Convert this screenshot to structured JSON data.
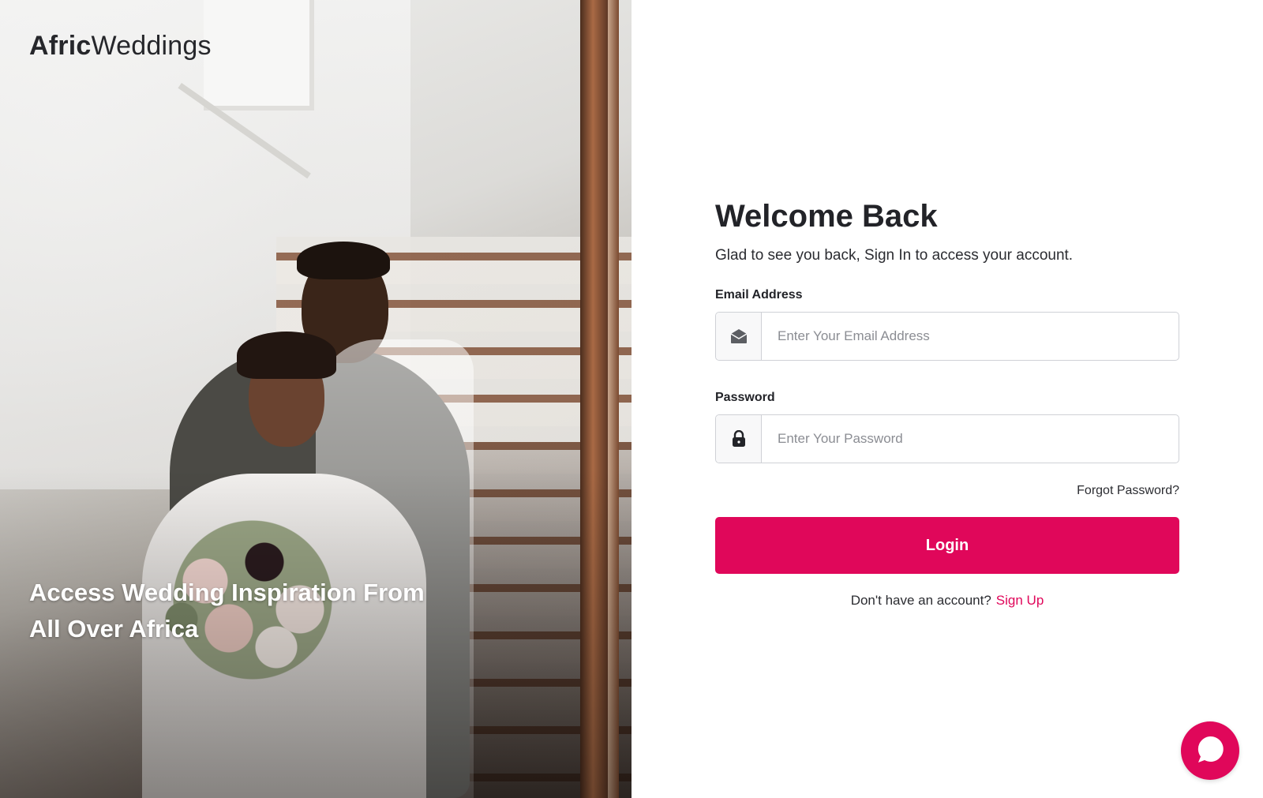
{
  "brand": {
    "name_bold": "Afric",
    "name_light": "Weddings"
  },
  "hero": {
    "tagline_line1": "Access Wedding Inspiration From",
    "tagline_line2": "All Over Africa",
    "image_alt": "Bride and groom seated on a staircase"
  },
  "login": {
    "title": "Welcome Back",
    "subtitle": "Glad to see you back, Sign In to access your account.",
    "email": {
      "label": "Email Address",
      "placeholder": "Enter Your Email Address",
      "value": "",
      "icon": "envelope-icon"
    },
    "password": {
      "label": "Password",
      "placeholder": "Enter Your Password",
      "value": "",
      "icon": "lock-icon"
    },
    "forgot_label": "Forgot Password?",
    "submit_label": "Login",
    "signup_prompt": "Don't have an account?",
    "signup_label": "Sign Up"
  },
  "chat": {
    "icon": "chat-bubble-icon"
  },
  "colors": {
    "accent": "#e0075a",
    "text": "#222328",
    "border": "#cfd1d6"
  }
}
